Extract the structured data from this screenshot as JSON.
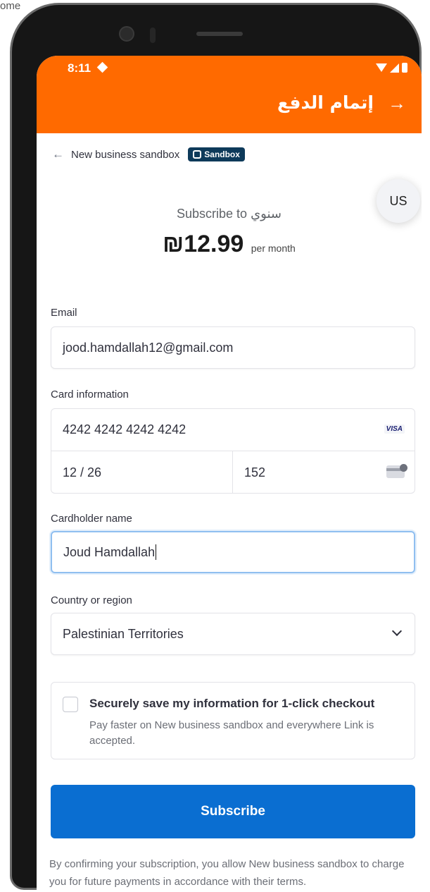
{
  "corner": {
    "text": "ome"
  },
  "status_bar": {
    "time": "8:11"
  },
  "app_bar": {
    "title": "إتمام الدفع",
    "forward_icon": "→"
  },
  "breadcrumb": {
    "back_icon": "←",
    "business_name": "New business sandbox",
    "badge": "Sandbox"
  },
  "language_button": {
    "label": "US"
  },
  "summary": {
    "subscribe_prefix": "Subscribe to",
    "product_name": "سنوي",
    "price": "₪12.99",
    "period": "per month"
  },
  "email": {
    "label": "Email",
    "value": "jood.hamdallah12@gmail.com"
  },
  "card": {
    "label": "Card information",
    "number": "4242 4242 4242 4242",
    "brand": "VISA",
    "expiry": "12 / 26",
    "cvc": "152"
  },
  "cardholder": {
    "label": "Cardholder name",
    "value": "Joud Hamdallah"
  },
  "country": {
    "label": "Country or region",
    "selected": "Palestinian Territories"
  },
  "save_info": {
    "checked": false,
    "title": "Securely save my information for 1-click checkout",
    "description": "Pay faster on New business sandbox and everywhere Link is accepted."
  },
  "subscribe_button": {
    "label": "Subscribe"
  },
  "legal": {
    "text": "By confirming your subscription, you allow New business sandbox to charge you for future payments in accordance with their terms."
  },
  "colors": {
    "app_bar": "#ff6a00",
    "primary_button": "#0a6ed1",
    "badge": "#0e3a5a",
    "focus_border": "#90bff0"
  }
}
